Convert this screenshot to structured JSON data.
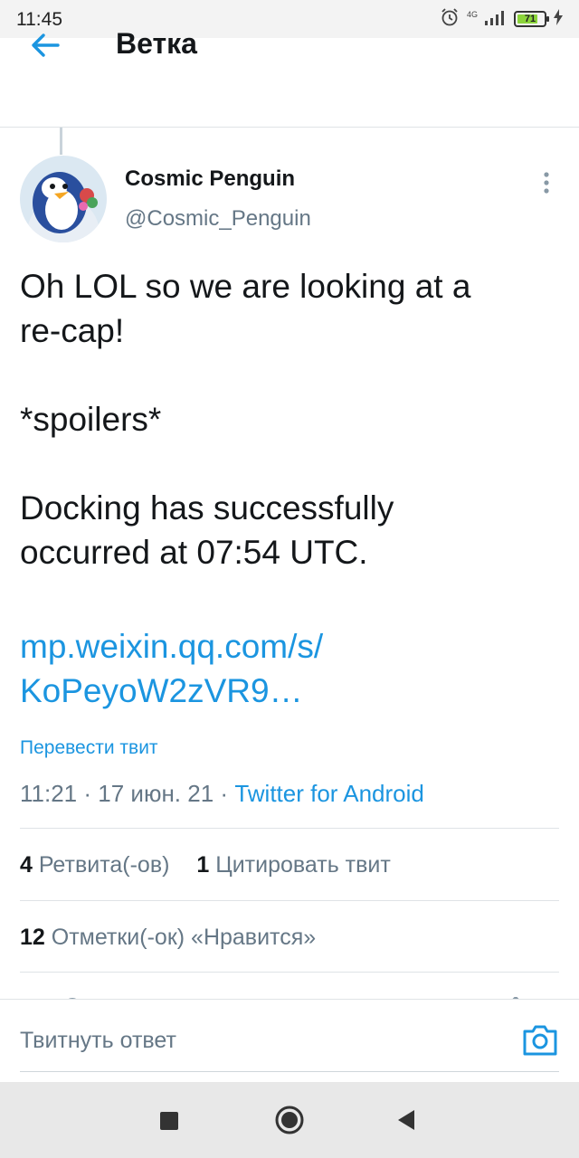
{
  "status_bar": {
    "time": "11:45",
    "network": "4G",
    "battery": "71"
  },
  "header": {
    "title": "Ветка"
  },
  "tweet": {
    "display_name": "Cosmic Penguin",
    "handle": "@Cosmic_Penguin",
    "text_lines": [
      "Oh LOL so we are looking at a",
      "re-cap!",
      "*spoilers*",
      "Docking has successfully",
      "occurred at 07:54 UTC."
    ],
    "link_lines": [
      "mp.weixin.qq.com/s/",
      "KoPeyoW2zVR9…"
    ],
    "translate_label": "Перевести твит",
    "time": "11:21",
    "date": "17 июн. 21",
    "source": "Twitter for Android",
    "separator": "·"
  },
  "stats": {
    "retweets_count": "4",
    "retweets_label": "Ретвита(-ов)",
    "quotes_count": "1",
    "quotes_label": "Цитировать твит",
    "likes_count": "12",
    "likes_label": "Отметки(-ок) «Нравится»"
  },
  "reply": {
    "placeholder": "Твитнуть ответ"
  },
  "colors": {
    "accent": "#1b95e0",
    "secondary_text": "#657786",
    "primary_text": "#14171a"
  },
  "icons": [
    "back-arrow-icon",
    "more-vertical-icon",
    "camera-icon",
    "alarm-icon",
    "signal-icon",
    "battery-icon",
    "nav-recents-icon",
    "nav-home-icon",
    "nav-back-icon"
  ]
}
